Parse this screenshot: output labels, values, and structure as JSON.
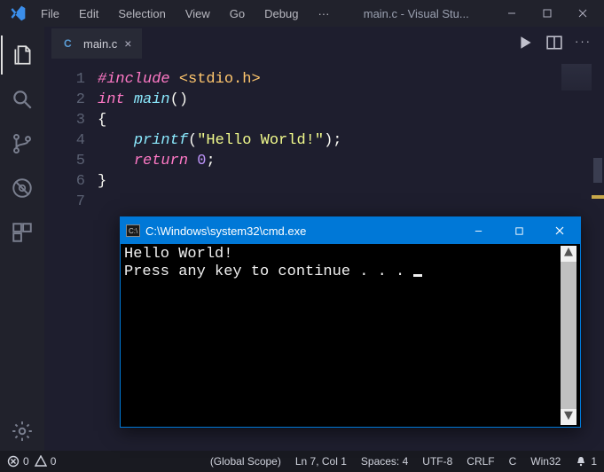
{
  "titlebar": {
    "title": "main.c - Visual Stu...",
    "menu": [
      "File",
      "Edit",
      "Selection",
      "View",
      "Go",
      "Debug"
    ],
    "ellipsis": "···"
  },
  "tabs": {
    "items": [
      {
        "label": "main.c",
        "active": true
      }
    ]
  },
  "editor": {
    "line_numbers": [
      "1",
      "2",
      "3",
      "4",
      "5",
      "6",
      "7"
    ],
    "code": {
      "include_kw": "#include",
      "include_path": "<stdio.h>",
      "int_kw": "int",
      "main_id": "main",
      "parens": "()",
      "open_brace": "{",
      "printf_id": "printf",
      "paren_open": "(",
      "string_lit": "\"Hello World!\"",
      "paren_close_semi": ");",
      "return_kw": "return",
      "zero": "0",
      "semicolon": ";",
      "close_brace": "}"
    }
  },
  "statusbar": {
    "errors": "0",
    "warnings": "0",
    "scope": "(Global Scope)",
    "cursor": "Ln 7, Col 1",
    "spaces": "Spaces: 4",
    "encoding": "UTF-8",
    "eol": "CRLF",
    "lang": "C",
    "platform": "Win32",
    "bell_count": "1"
  },
  "console": {
    "title": "C:\\Windows\\system32\\cmd.exe",
    "output_line1": "Hello World!",
    "output_line2": "Press any key to continue . . . "
  }
}
